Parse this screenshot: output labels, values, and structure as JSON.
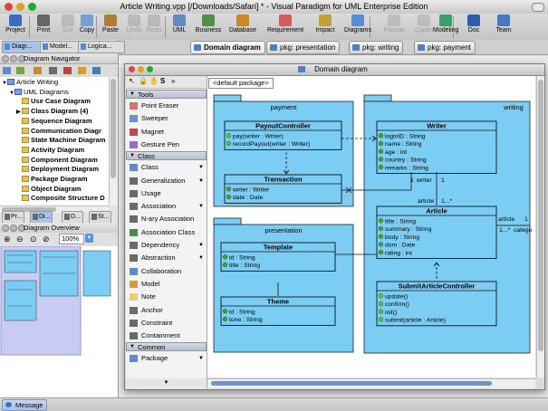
{
  "window": {
    "title": "Article Writing.vpp [/Downloads/Safari] * - Visual Paradigm for UML Enterprise Edition"
  },
  "toolbar": {
    "items": [
      {
        "label": "Project",
        "icon": "project-icon"
      },
      {
        "label": "Print",
        "icon": "print-icon"
      },
      {
        "label": "Cut",
        "icon": "cut-icon",
        "disabled": true
      },
      {
        "label": "Copy",
        "icon": "copy-icon"
      },
      {
        "label": "Paste",
        "icon": "paste-icon"
      },
      {
        "label": "Undo",
        "icon": "undo-icon",
        "disabled": true
      },
      {
        "label": "Redo",
        "icon": "redo-icon",
        "disabled": true
      },
      {
        "label": "UML",
        "icon": "uml-icon"
      },
      {
        "label": "Business",
        "icon": "business-icon"
      },
      {
        "label": "Database",
        "icon": "database-icon"
      },
      {
        "label": "Requirement",
        "icon": "requirement-icon"
      },
      {
        "label": "Impact",
        "icon": "impact-icon"
      },
      {
        "label": "Diagrams",
        "icon": "diagrams-icon"
      },
      {
        "label": "Format",
        "icon": "format-icon",
        "disabled": true
      },
      {
        "label": "Copier",
        "icon": "copier-icon",
        "disabled": true
      },
      {
        "label": "Modeling",
        "icon": "modeling-icon"
      },
      {
        "label": "Doc",
        "icon": "doc-icon"
      },
      {
        "label": "Team",
        "icon": "team-icon"
      }
    ]
  },
  "diagram_tabs": [
    {
      "label": "Domain diagram",
      "active": true
    },
    {
      "label": "pkg: presentation",
      "active": false
    },
    {
      "label": "pkg: writing",
      "active": false
    },
    {
      "label": "pkg: payment",
      "active": false
    }
  ],
  "left_panel": {
    "tabs": [
      "Diagr...",
      "Model...",
      "Logica..."
    ],
    "navigator_title": "Diagram Navigator",
    "tree": [
      {
        "label": "Article Writing",
        "level": 0,
        "bold": false,
        "expander": "▼"
      },
      {
        "label": "UML Diagrams",
        "level": 1,
        "bold": false,
        "expander": "▼"
      },
      {
        "label": "Use Case Diagram",
        "level": 2,
        "bold": true,
        "expander": ""
      },
      {
        "label": "Class Diagram (4)",
        "level": 2,
        "bold": true,
        "expander": "▶"
      },
      {
        "label": "Sequence Diagram",
        "level": 2,
        "bold": true,
        "expander": ""
      },
      {
        "label": "Communication Diagr",
        "level": 2,
        "bold": true,
        "expander": ""
      },
      {
        "label": "State Machine Diagram",
        "level": 2,
        "bold": true,
        "expander": ""
      },
      {
        "label": "Activity Diagram",
        "level": 2,
        "bold": true,
        "expander": ""
      },
      {
        "label": "Component Diagram",
        "level": 2,
        "bold": true,
        "expander": ""
      },
      {
        "label": "Deployment Diagram",
        "level": 2,
        "bold": true,
        "expander": ""
      },
      {
        "label": "Package Diagram",
        "level": 2,
        "bold": true,
        "expander": ""
      },
      {
        "label": "Object Diagram",
        "level": 2,
        "bold": true,
        "expander": ""
      },
      {
        "label": "Composite Structure D",
        "level": 2,
        "bold": true,
        "expander": ""
      }
    ],
    "bottom_tabs": [
      "Pr...",
      "Di...",
      "D...",
      "St..."
    ],
    "overview_title": "Diagram Overview",
    "zoom": "100%"
  },
  "diagram_window": {
    "title": "Domain diagram",
    "package_selector": "<default package>",
    "palette": {
      "groups": [
        {
          "name": "Tools",
          "items": [
            "Point Eraser",
            "Sweeper",
            "Magnet",
            "Gesture Pen"
          ]
        },
        {
          "name": "Class",
          "items": [
            "Class",
            "Generalization",
            "Usage",
            "Association",
            "N-ary Association",
            "Association Class",
            "Dependency",
            "Abstraction",
            "Collaboration",
            "Model",
            "Note",
            "Anchor",
            "Constraint",
            "Containment"
          ]
        },
        {
          "name": "Common",
          "items": [
            "Package"
          ]
        }
      ]
    }
  },
  "diagram": {
    "packages": {
      "payment": "payment",
      "writing": "writing",
      "presentation": "presentation"
    },
    "classes": {
      "PayoutController": {
        "name": "PayoutController",
        "operations": [
          "pay(writer : Writer)",
          "recordPayout(writer : Writer)"
        ]
      },
      "Transaction": {
        "name": "Transaction",
        "attributes": [
          "writer : Writer",
          "date : Date"
        ]
      },
      "Writer": {
        "name": "Writer",
        "attributes": [
          "loginID : String",
          "name : String",
          "age : int",
          "country : String",
          "remarks : String"
        ]
      },
      "Article": {
        "name": "Article",
        "attributes": [
          "title : String",
          "summary : String",
          "body : String",
          "dom : Date",
          "rating : int"
        ]
      },
      "Template": {
        "name": "Template",
        "attributes": [
          "id : String",
          "title : String"
        ]
      },
      "Theme": {
        "name": "Theme",
        "attributes": [
          "id : String",
          "tone : String"
        ]
      },
      "SubmitArticleController": {
        "name": "SubmitArticleController",
        "operations": [
          "update()",
          "confirm()",
          "init()",
          "submit(article : Article)"
        ]
      }
    },
    "labels": {
      "writer_role": "writer",
      "mult_one_a": "1",
      "mult_one_b": "1",
      "article_role": "article",
      "mult_many": "1...*",
      "article_role_2": "article",
      "mult_one_c": "1",
      "mult_many_2": "1...*",
      "catego": "catego"
    }
  },
  "status_bar": {
    "message_tab": "Message"
  },
  "colors": {
    "class_fill": "#7ccdf3",
    "package_fill": "#7ccdf3",
    "selection": "#a9c4ea"
  }
}
